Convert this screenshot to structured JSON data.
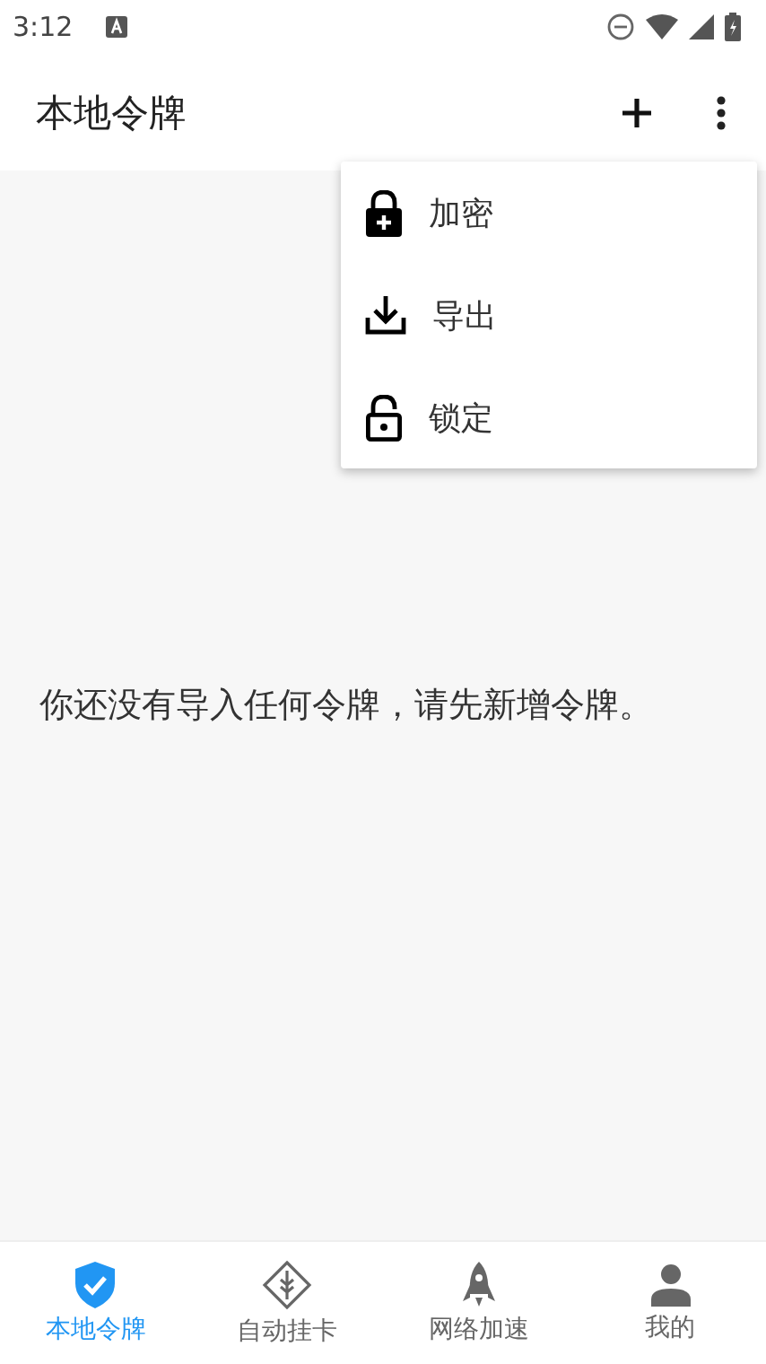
{
  "status_bar": {
    "time": "3:12"
  },
  "app_bar": {
    "title": "本地令牌"
  },
  "menu": [
    {
      "kind": "encrypt",
      "label": "加密"
    },
    {
      "kind": "export",
      "label": "导出"
    },
    {
      "kind": "lock",
      "label": "锁定"
    }
  ],
  "empty_message": "你还没有导入任何令牌，请先新增令牌。",
  "bottom_nav": [
    {
      "kind": "shield",
      "label": "本地令牌",
      "selected": true
    },
    {
      "kind": "wheat",
      "label": "自动挂卡",
      "selected": false
    },
    {
      "kind": "rocket",
      "label": "网络加速",
      "selected": false
    },
    {
      "kind": "person",
      "label": "我的",
      "selected": false
    }
  ]
}
